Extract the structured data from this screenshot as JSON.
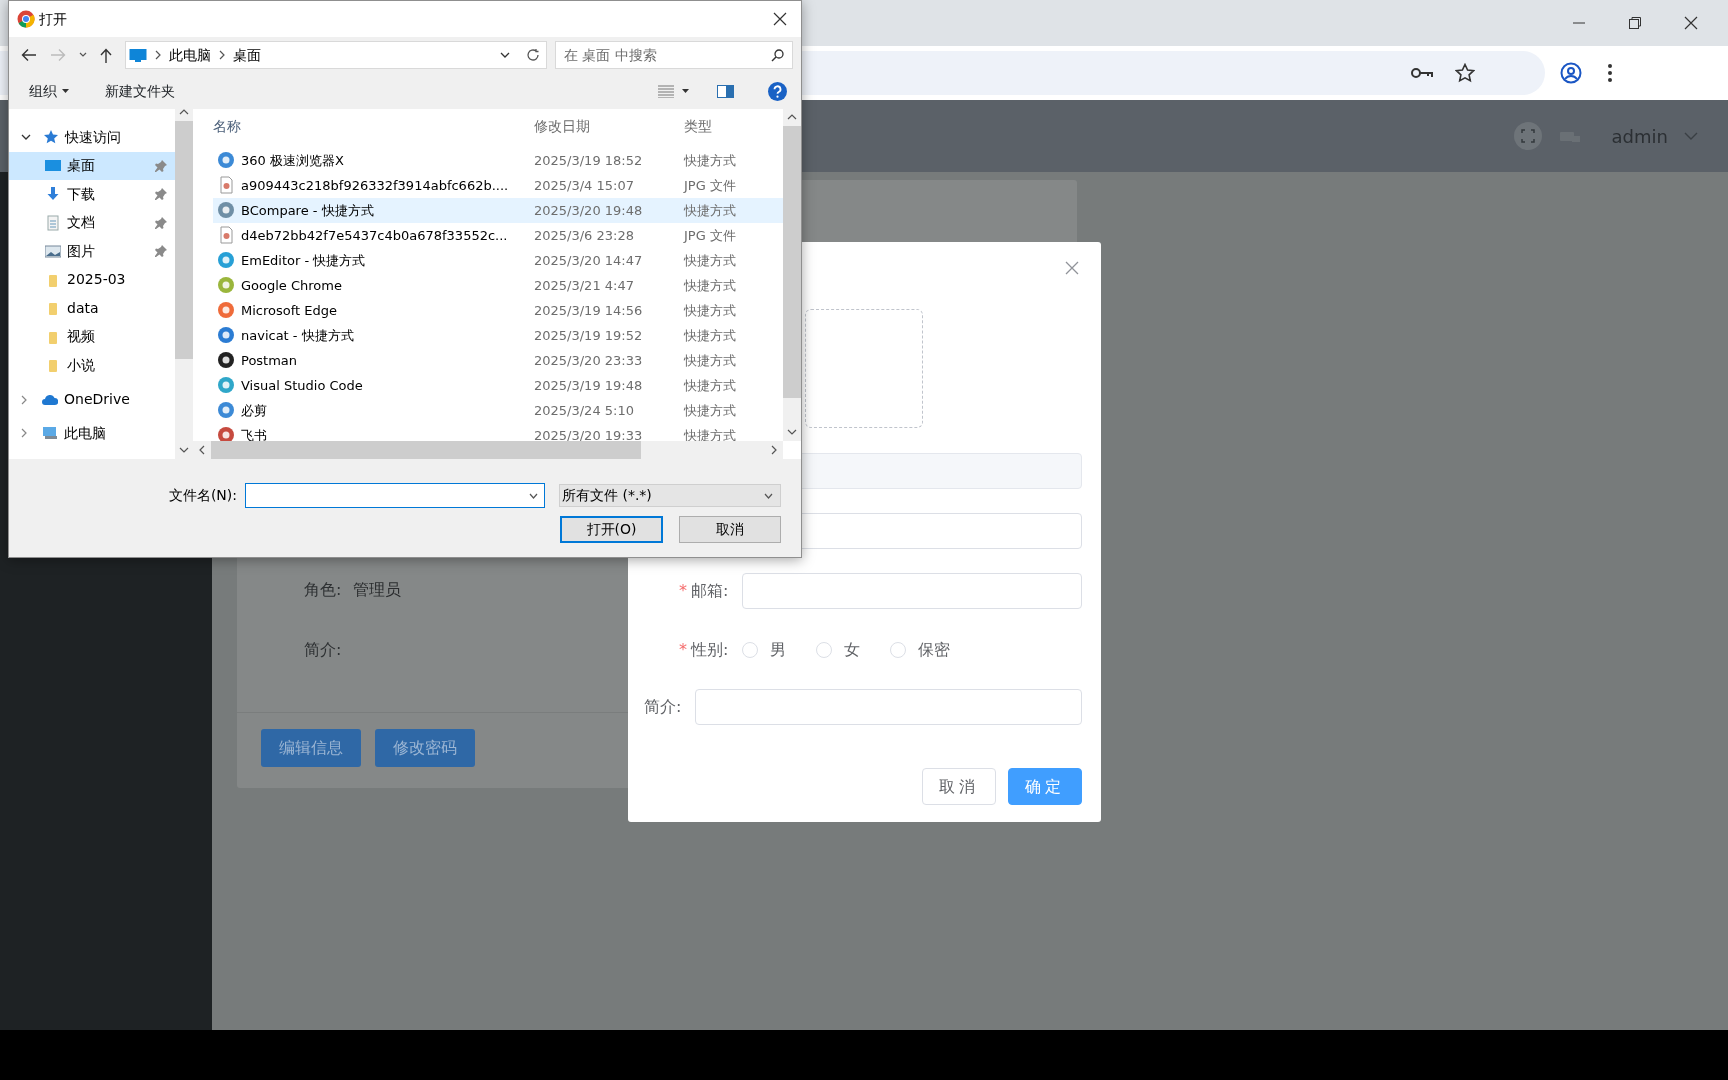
{
  "app": {
    "user": "admin"
  },
  "profile_card": {
    "fields": [
      {
        "label": "角色:",
        "value": "管理员"
      },
      {
        "label": "简介:"
      }
    ],
    "buttons": [
      "编辑信息",
      "修改密码"
    ]
  },
  "modal": {
    "fields": [
      {
        "kind": "disabled-input"
      },
      {
        "kind": "input"
      },
      {
        "kind": "input",
        "label": "邮箱:",
        "required_mark": "*"
      },
      {
        "kind": "radio",
        "label": "性别:",
        "required_mark": "*",
        "options": [
          {
            "label": "男",
            "selected": false
          },
          {
            "label": "女",
            "selected": false
          },
          {
            "label": "保密",
            "selected": false
          }
        ]
      },
      {
        "kind": "input",
        "label": "简介:"
      }
    ],
    "buttons": [
      {
        "label": "取消",
        "kind": "default"
      },
      {
        "label": "确定",
        "kind": "primary"
      }
    ]
  },
  "file_dialog": {
    "title": "打开",
    "breadcrumb": [
      "此电脑",
      "桌面"
    ],
    "search": {
      "placeholder": "在 桌面 中搜索"
    },
    "toolbar": [
      "组织",
      "新建文件夹"
    ],
    "nav": [
      {
        "label": "快速访问",
        "kind": "quick-access",
        "expanded": true,
        "selected": false,
        "children": [
          {
            "label": "桌面",
            "kind": "desktop",
            "pinned": true,
            "selected": true
          },
          {
            "label": "下载",
            "kind": "download",
            "pinned": true,
            "selected": false
          },
          {
            "label": "文档",
            "kind": "documents",
            "pinned": true,
            "selected": false
          },
          {
            "label": "图片",
            "kind": "pictures",
            "pinned": true,
            "selected": false
          },
          {
            "label": "2025-03",
            "kind": "folder",
            "pinned": false,
            "selected": false
          },
          {
            "label": "data",
            "kind": "folder",
            "pinned": false,
            "selected": false
          },
          {
            "label": "视频",
            "kind": "folder",
            "pinned": false,
            "selected": false
          },
          {
            "label": "小说",
            "kind": "folder",
            "pinned": false,
            "selected": false
          }
        ]
      },
      {
        "label": "OneDrive",
        "kind": "cloud",
        "expanded": false,
        "selected": false
      },
      {
        "label": "此电脑",
        "kind": "computer",
        "expanded": false,
        "selected": false
      }
    ],
    "columns": [
      "名称",
      "修改日期",
      "类型"
    ],
    "files": [
      {
        "name": "360 极速浏览器X",
        "date": "2025/3/19 18:52",
        "type": "快捷方式",
        "kind": "app",
        "selected": false
      },
      {
        "name": "a909443c218bf926332f3914abfc662b....",
        "date": "2025/3/4 15:07",
        "type": "JPG 文件",
        "kind": "image",
        "selected": false
      },
      {
        "name": "BCompare - 快捷方式",
        "date": "2025/3/20 19:48",
        "type": "快捷方式",
        "kind": "app",
        "selected": true
      },
      {
        "name": "d4eb72bb42f7e5437c4b0a678f33552c...",
        "date": "2025/3/6 23:28",
        "type": "JPG 文件",
        "kind": "image",
        "selected": false
      },
      {
        "name": "EmEditor - 快捷方式",
        "date": "2025/3/20 14:47",
        "type": "快捷方式",
        "kind": "app",
        "selected": false
      },
      {
        "name": "Google Chrome",
        "date": "2025/3/21 4:47",
        "type": "快捷方式",
        "kind": "app",
        "selected": false
      },
      {
        "name": "Microsoft Edge",
        "date": "2025/3/19 14:56",
        "type": "快捷方式",
        "kind": "app",
        "selected": false
      },
      {
        "name": "navicat - 快捷方式",
        "date": "2025/3/19 19:52",
        "type": "快捷方式",
        "kind": "app",
        "selected": false
      },
      {
        "name": "Postman",
        "date": "2025/3/20 23:33",
        "type": "快捷方式",
        "kind": "app",
        "selected": false
      },
      {
        "name": "Visual Studio Code",
        "date": "2025/3/19 19:48",
        "type": "快捷方式",
        "kind": "app",
        "selected": false
      },
      {
        "name": "必剪",
        "date": "2025/3/24 5:10",
        "type": "快捷方式",
        "kind": "app",
        "selected": false
      },
      {
        "name": "飞书",
        "date": "2025/3/20 19:33",
        "type": "快捷方式",
        "kind": "app",
        "selected": false
      }
    ],
    "filename": {
      "label": "文件名(N):"
    },
    "filter": "所有文件 (*.*)",
    "buttons": [
      {
        "label": "打开(O)",
        "kind": "default"
      },
      {
        "label": "取消",
        "kind": "normal"
      }
    ]
  }
}
